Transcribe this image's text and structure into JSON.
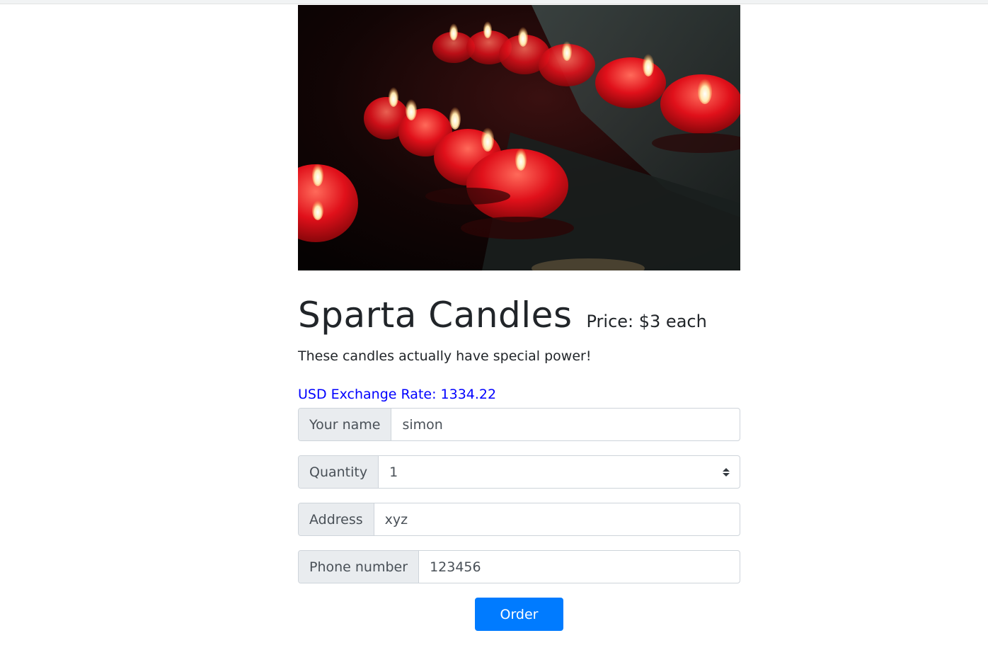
{
  "product": {
    "title": "Sparta Candles",
    "price": "Price: $3 each",
    "description": "These candles actually have special power!"
  },
  "exchange": {
    "label": "USD Exchange Rate: ",
    "value": "1334.22"
  },
  "form": {
    "name_label": "Your name",
    "name_value": "simon",
    "quantity_label": "Quantity",
    "quantity_value": "1",
    "address_label": "Address",
    "address_value": "xyz",
    "phone_label": "Phone number",
    "phone_value": "123456",
    "order_button": "Order"
  },
  "colors": {
    "accent": "#007bff",
    "exchange_text": "#0000ff",
    "addon_bg": "#e9ecef"
  },
  "image": {
    "subject": "red-candles-photo"
  }
}
